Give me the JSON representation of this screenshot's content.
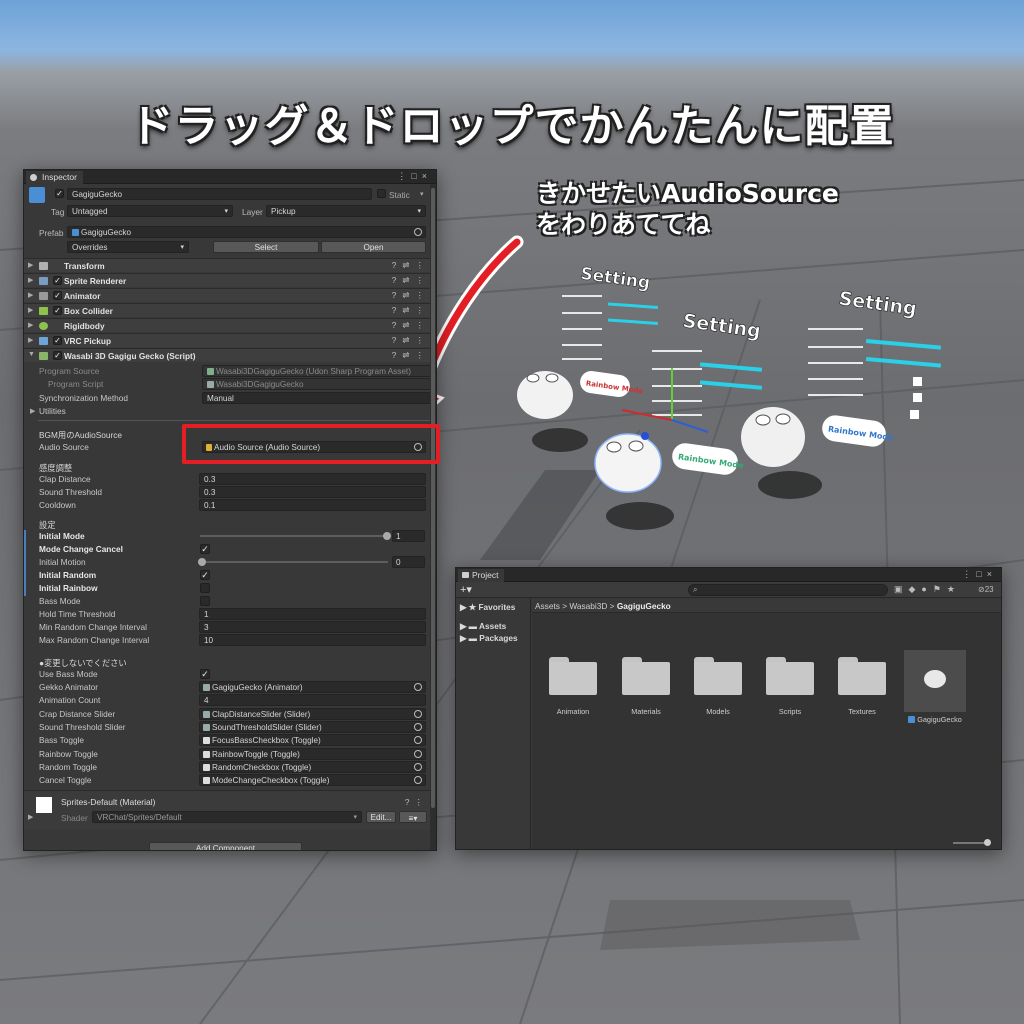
{
  "headline": "ドラッグ＆ドロップでかんたんに配置",
  "callout": [
    "きかせたいAudioSource",
    "をわりあててね"
  ],
  "scene": {
    "setting_title": "Setting",
    "rainbow_button": "Rainbow Mode"
  },
  "inspector": {
    "tab": "Inspector",
    "object_name": "GagiguGecko",
    "static_label": "Static",
    "tag_label": "Tag",
    "tag_value": "Untagged",
    "layer_label": "Layer",
    "layer_value": "Pickup",
    "prefab_label": "Prefab",
    "prefab_value": "GagiguGecko",
    "overrides": "Overrides",
    "select": "Select",
    "open": "Open",
    "components": [
      {
        "name": "Transform",
        "color": "#b0b0b0"
      },
      {
        "name": "Sprite Renderer",
        "color": "#7a9cc2"
      },
      {
        "name": "Animator",
        "color": "#9a9a9a"
      },
      {
        "name": "Box Collider",
        "color": "#8ec24f"
      },
      {
        "name": "Rigidbody",
        "color": "#8ec24f"
      },
      {
        "name": "VRC Pickup",
        "color": "#6fa5d6"
      },
      {
        "name": "Wasabi 3D Gagigu Gecko (Script)",
        "color": "#8ab46a"
      }
    ],
    "program_source_label": "Program Source",
    "program_source_value": "Wasabi3DGagiguGecko (Udon Sharp Program Asset)",
    "program_script_label": "Program Script",
    "program_script_value": "Wasabi3DGagiguGecko",
    "sync_label": "Synchronization Method",
    "sync_value": "Manual",
    "utilities": "Utilities",
    "bgm_header": "BGM用のAudioSource",
    "audio_source_label": "Audio Source",
    "audio_source_value": "Audio Source (Audio Source)",
    "sensitivity_header": "感度調整",
    "clap_distance_label": "Clap Distance",
    "clap_distance_value": "0.3",
    "sound_threshold_label": "Sound Threshold",
    "sound_threshold_value": "0.3",
    "cooldown_label": "Cooldown",
    "cooldown_value": "0.1",
    "settings_header": "設定",
    "initial_mode_label": "Initial Mode",
    "initial_mode_value": "1",
    "mode_change_cancel_label": "Mode Change Cancel",
    "initial_motion_label": "Initial Motion",
    "initial_motion_value": "0",
    "initial_random_label": "Initial Random",
    "initial_rainbow_label": "Initial Rainbow",
    "bass_mode_label": "Bass Mode",
    "hold_time_label": "Hold Time Threshold",
    "hold_time_value": "1",
    "min_random_label": "Min Random Change Interval",
    "min_random_value": "3",
    "max_random_label": "Max Random Change Interval",
    "max_random_value": "10",
    "nochange_header": "●変更しないでください",
    "use_bass_label": "Use Bass Mode",
    "gekko_animator_label": "Gekko Animator",
    "gekko_animator_value": "GagiguGecko (Animator)",
    "animation_count_label": "Animation Count",
    "animation_count_value": "4",
    "crap_slider_label": "Crap Distance Slider",
    "crap_slider_value": "ClapDistanceSlider (Slider)",
    "sound_slider_label": "Sound Threshold Slider",
    "sound_slider_value": "SoundThresholdSlider (Slider)",
    "bass_toggle_label": "Bass Toggle",
    "bass_toggle_value": "FocusBassCheckbox (Toggle)",
    "rainbow_toggle_label": "Rainbow Toggle",
    "rainbow_toggle_value": "RainbowToggle (Toggle)",
    "random_toggle_label": "Random Toggle",
    "random_toggle_value": "RandomCheckbox (Toggle)",
    "cancel_toggle_label": "Cancel Toggle",
    "cancel_toggle_value": "ModeChangeCheckbox (Toggle)",
    "material_name": "Sprites-Default (Material)",
    "shader_label": "Shader",
    "shader_value": "VRChat/Sprites/Default",
    "edit": "Edit...",
    "add_component": "Add Component"
  },
  "project": {
    "tab": "Project",
    "favorites": "Favorites",
    "assets": "Assets",
    "packages": "Packages",
    "breadcrumb": [
      "Assets",
      "Wasabi3D",
      "GagiguGecko"
    ],
    "hidden_count": "23",
    "items": [
      "Animation",
      "Materials",
      "Models",
      "Scripts",
      "Textures"
    ],
    "prefab_item": "GagiguGecko"
  },
  "colors": {
    "highlight": "#e31e24",
    "accent_blue": "#4a7fbf"
  }
}
